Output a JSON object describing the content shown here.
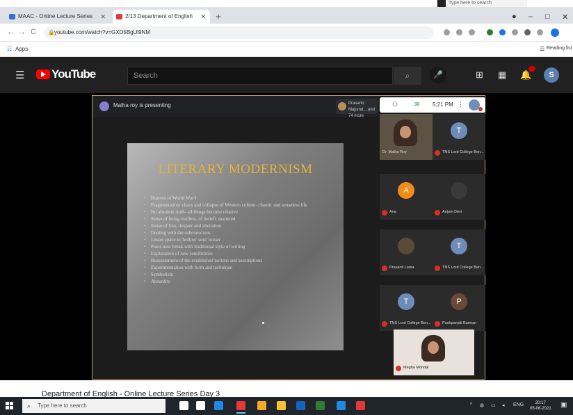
{
  "screen_top": {
    "search_popup_text": "Type here to search"
  },
  "browser": {
    "tabs": [
      {
        "label": "MAAC - Online Lecture Series",
        "active": false,
        "favicon_color": "#3b6bd1"
      },
      {
        "label": "2/13 Department of English",
        "active": true,
        "favicon_color": "#e53935"
      }
    ],
    "new_tab": "+",
    "window_controls": {
      "minimize": "–",
      "maximize": "□",
      "close": "✕"
    },
    "nav": {
      "back": "←",
      "forward": "→",
      "reload": "C"
    },
    "url": "youtube.com/watch?v=GXD5BgUl9NM",
    "bookmarks": {
      "apps_label": "Apps",
      "reading_list_label": "Reading list"
    },
    "extension_colors": [
      "#9e9e9e",
      "#9e9e9e",
      "#9e9e9e",
      "#2e7d32",
      "#1a73e8",
      "#9e9e9e",
      "#5f6368",
      "#9e9e9e",
      "#1a73e8"
    ]
  },
  "youtube": {
    "logo_text": "YouTube",
    "search_placeholder": "Search",
    "avatar_letter": "S",
    "brand_color": "#ff0000"
  },
  "meet": {
    "presenter_text": "Malha roy is presenting",
    "pinned_user_text": "Prasanti Majumd... and 74 more",
    "time": "5:21 PM",
    "slide": {
      "title": "LITERARY MODERNISM",
      "bullets": [
        "Horrors of World War I",
        "Fragmentation/ chaos and collapse of Western culture- chaotic and senseless life",
        "No absolute truth- all things become relative",
        "Sense of being rootless, of beliefs shattered",
        "Sense of loss, despair and alienation",
        "Dealing with the subconscious",
        "Lesser space to 'hollow' soul 'ocean'",
        "Poets now break with traditional style of writing",
        "Exploration of new sensibilities",
        "Reassessment of the established notions and assumptions",
        "Experimentation with form and technique",
        "Symbolism",
        "Absurdity"
      ]
    },
    "participants": [
      {
        "name": "Dr. Malha Roy",
        "initial": "",
        "avatar_color": "",
        "video": true
      },
      {
        "name": "TNS Lord College Ben...",
        "initial": "T",
        "avatar_color": "#6d8db8",
        "video": false
      },
      {
        "name": "Ana",
        "initial": "A",
        "avatar_color": "#f08c1a",
        "video": false
      },
      {
        "name": "Anjum Devi",
        "initial": "",
        "avatar_color": "#3a3a3a",
        "video": false
      },
      {
        "name": "Prasanti Lama",
        "initial": "",
        "avatar_color": "#5a4a3a",
        "video": false
      },
      {
        "name": "TNS Lord College Ben...",
        "initial": "T",
        "avatar_color": "#6d8db8",
        "video": false
      },
      {
        "name": "TNS Lord College Ben...",
        "initial": "T",
        "avatar_color": "#6d8db8",
        "video": false
      },
      {
        "name": "Pushpanjali Barman",
        "initial": "P",
        "avatar_color": "#6a4a36",
        "video": false
      },
      {
        "name": "Megha Mondal",
        "initial": "",
        "avatar_color": "",
        "video": true
      }
    ]
  },
  "below_video_title": "Department of English - Online Lecture Series Day 3",
  "taskbar": {
    "search_placeholder": "Type here to search",
    "app_colors": [
      "#ffffff",
      "#ffffff",
      "#1e88e5",
      "#e53935",
      "#f9a825",
      "#fbc02d",
      "#1565c0",
      "#2e7d32",
      "#1e88e5",
      "#e53935",
      "#1976d2"
    ],
    "tray_lang": "ENG",
    "clock_time": "20:17",
    "clock_date": "05-06-2021"
  }
}
